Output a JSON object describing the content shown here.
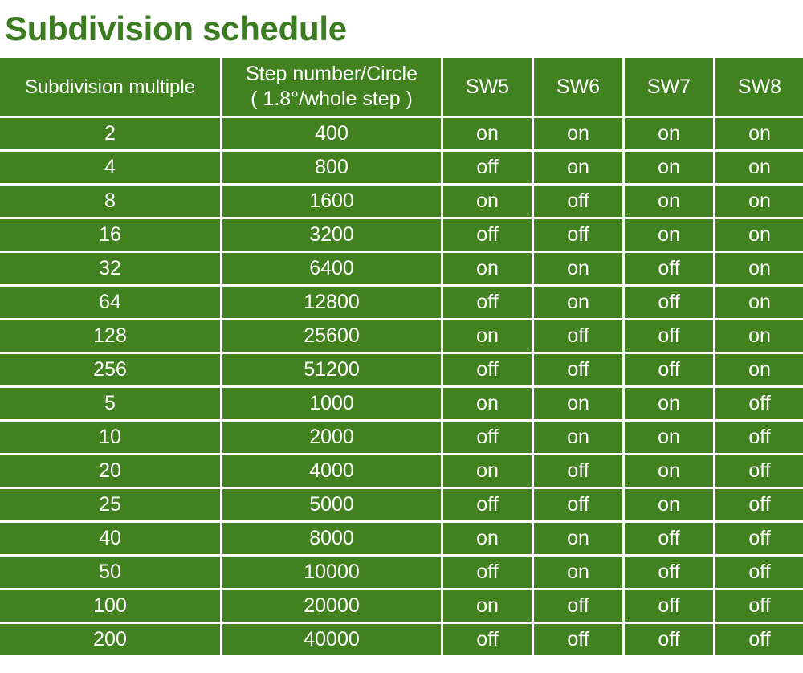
{
  "page": {
    "title": "Subdivision schedule",
    "accent_color": "#3d7d22",
    "cell_color": "#42811f",
    "text_color": "#ffffff",
    "background_color": "#ffffff"
  },
  "table": {
    "headers": {
      "col_a": "Subdivision multiple",
      "col_b_line1": "Step number/Circle",
      "col_b_line2": "( 1.8°/whole step )",
      "sw5": "SW5",
      "sw6": "SW6",
      "sw7": "SW7",
      "sw8": "SW8"
    },
    "rows": [
      {
        "multiple": "2",
        "steps": "400",
        "sw5": "on",
        "sw6": "on",
        "sw7": "on",
        "sw8": "on"
      },
      {
        "multiple": "4",
        "steps": "800",
        "sw5": "off",
        "sw6": "on",
        "sw7": "on",
        "sw8": "on"
      },
      {
        "multiple": "8",
        "steps": "1600",
        "sw5": "on",
        "sw6": "off",
        "sw7": "on",
        "sw8": "on"
      },
      {
        "multiple": "16",
        "steps": "3200",
        "sw5": "off",
        "sw6": "off",
        "sw7": "on",
        "sw8": "on"
      },
      {
        "multiple": "32",
        "steps": "6400",
        "sw5": "on",
        "sw6": "on",
        "sw7": "off",
        "sw8": "on"
      },
      {
        "multiple": "64",
        "steps": "12800",
        "sw5": "off",
        "sw6": "on",
        "sw7": "off",
        "sw8": "on"
      },
      {
        "multiple": "128",
        "steps": "25600",
        "sw5": "on",
        "sw6": "off",
        "sw7": "off",
        "sw8": "on"
      },
      {
        "multiple": "256",
        "steps": "51200",
        "sw5": "off",
        "sw6": "off",
        "sw7": "off",
        "sw8": "on"
      },
      {
        "multiple": "5",
        "steps": "1000",
        "sw5": "on",
        "sw6": "on",
        "sw7": "on",
        "sw8": "off"
      },
      {
        "multiple": "10",
        "steps": "2000",
        "sw5": "off",
        "sw6": "on",
        "sw7": "on",
        "sw8": "off"
      },
      {
        "multiple": "20",
        "steps": "4000",
        "sw5": "on",
        "sw6": "off",
        "sw7": "on",
        "sw8": "off"
      },
      {
        "multiple": "25",
        "steps": "5000",
        "sw5": "off",
        "sw6": "off",
        "sw7": "on",
        "sw8": "off"
      },
      {
        "multiple": "40",
        "steps": "8000",
        "sw5": "on",
        "sw6": "on",
        "sw7": "off",
        "sw8": "off"
      },
      {
        "multiple": "50",
        "steps": "10000",
        "sw5": "off",
        "sw6": "on",
        "sw7": "off",
        "sw8": "off"
      },
      {
        "multiple": "100",
        "steps": "20000",
        "sw5": "on",
        "sw6": "off",
        "sw7": "off",
        "sw8": "off"
      },
      {
        "multiple": "200",
        "steps": "40000",
        "sw5": "off",
        "sw6": "off",
        "sw7": "off",
        "sw8": "off"
      }
    ]
  }
}
